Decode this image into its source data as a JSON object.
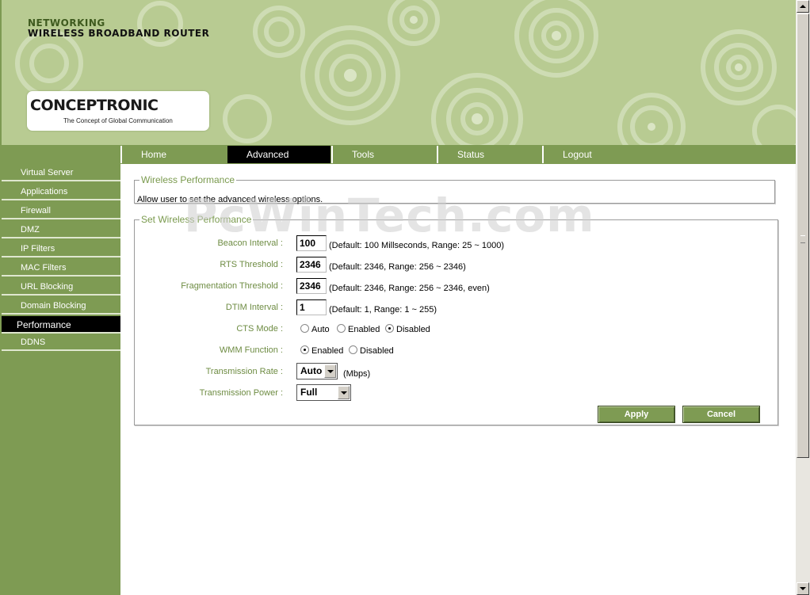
{
  "header": {
    "line1": "NETWORKING",
    "line2": "WIRELESS BROADBAND ROUTER",
    "logo_name": "CONCEPTRONIC",
    "logo_tagline": "The Concept of Global Communication",
    "colors": {
      "header_bg": "#b8cb92",
      "accent_green": "#7e9b53",
      "active": "#000000"
    }
  },
  "nav": {
    "tabs": [
      {
        "label": "Home",
        "active": false
      },
      {
        "label": "Advanced",
        "active": true
      },
      {
        "label": "Tools",
        "active": false
      },
      {
        "label": "Status",
        "active": false
      },
      {
        "label": "Logout",
        "active": false
      }
    ]
  },
  "sidebar": {
    "items": [
      {
        "label": "Virtual Server",
        "active": false
      },
      {
        "label": "Applications",
        "active": false
      },
      {
        "label": "Firewall",
        "active": false
      },
      {
        "label": "DMZ",
        "active": false
      },
      {
        "label": "IP Filters",
        "active": false
      },
      {
        "label": "MAC Filters",
        "active": false
      },
      {
        "label": "URL Blocking",
        "active": false
      },
      {
        "label": "Domain Blocking",
        "active": false
      },
      {
        "label": "Performance",
        "active": true
      },
      {
        "label": "DDNS",
        "active": false
      }
    ]
  },
  "wireless_performance": {
    "legend": "Wireless Performance",
    "description": "Allow user to set the advanced wireless options."
  },
  "set_performance": {
    "legend": "Set Wireless Performance",
    "beacon": {
      "label": "Beacon Interval :",
      "value": "100",
      "hint": "(Default: 100 Millseconds, Range: 25 ~ 1000)"
    },
    "rts": {
      "label": "RTS Threshold :",
      "value": "2346",
      "hint": "(Default: 2346, Range: 256 ~ 2346)"
    },
    "frag": {
      "label": "Fragmentation Threshold :",
      "value": "2346",
      "hint": "(Default: 2346, Range: 256 ~ 2346, even)"
    },
    "dtim": {
      "label": "DTIM Interval :",
      "value": "1",
      "hint": "(Default: 1, Range: 1 ~ 255)"
    },
    "cts": {
      "label": "CTS Mode :",
      "options": [
        "Auto",
        "Enabled",
        "Disabled"
      ],
      "selected": "Disabled"
    },
    "wmm": {
      "label": "WMM Function :",
      "options": [
        "Enabled",
        "Disabled"
      ],
      "selected": "Enabled"
    },
    "rate": {
      "label": "Transmission Rate :",
      "value": "Auto",
      "unit": "(Mbps)"
    },
    "power": {
      "label": "Transmission Power :",
      "value": "Full"
    },
    "apply_label": "Apply",
    "cancel_label": "Cancel"
  },
  "watermark": "PcWinTech.com"
}
